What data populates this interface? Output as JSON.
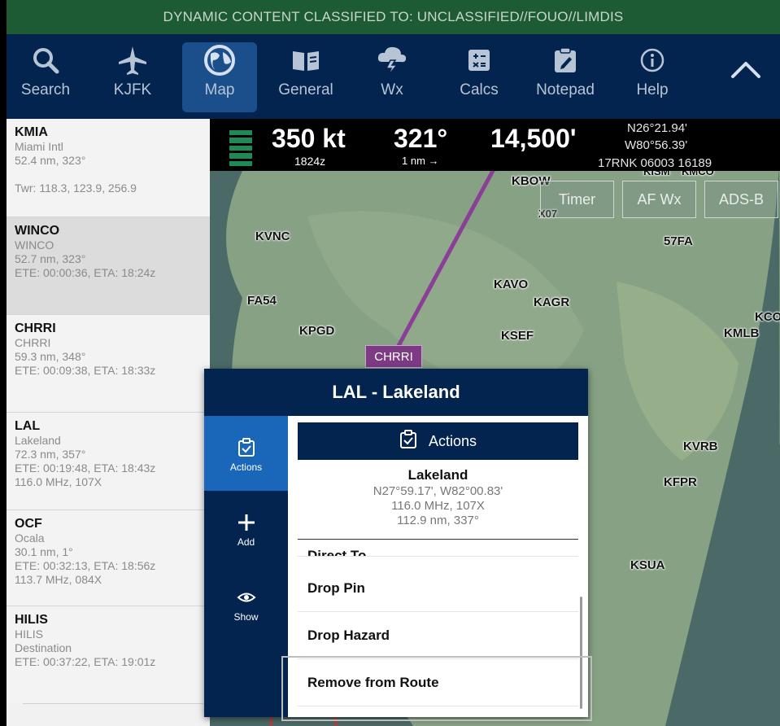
{
  "banner": "DYNAMIC CONTENT CLASSIFIED TO: UNCLASSIFIED//FOUO//LIMDIS",
  "nav": {
    "items": [
      {
        "label": "Search",
        "icon": "search-icon"
      },
      {
        "label": "KJFK",
        "icon": "airplane-icon"
      },
      {
        "label": "Map",
        "icon": "globe-icon"
      },
      {
        "label": "General",
        "icon": "book-icon"
      },
      {
        "label": "Wx",
        "icon": "storm-cloud-icon"
      },
      {
        "label": "Calcs",
        "icon": "calculator-icon"
      },
      {
        "label": "Notepad",
        "icon": "notepad-icon"
      },
      {
        "label": "Help",
        "icon": "info-icon"
      }
    ],
    "active": "Map"
  },
  "waypoints": [
    {
      "id": "KMIA",
      "lines": [
        "Miami Intl",
        "52.4 nm, 323°",
        "",
        "Twr: 118.3, 123.9, 256.9"
      ]
    },
    {
      "id": "WINCO",
      "lines": [
        "WINCO",
        "52.7 nm, 323°",
        "ETE: 00:00:36, ETA: 18:24z"
      ]
    },
    {
      "id": "CHRRI",
      "lines": [
        "CHRRI",
        "59.3 nm, 348°",
        "ETE: 00:09:38, ETA: 18:33z"
      ]
    },
    {
      "id": "LAL",
      "lines": [
        "Lakeland",
        "72.3 nm, 357°",
        "ETE: 00:19:48, ETA: 18:43z",
        "116.0 MHz, 107X"
      ]
    },
    {
      "id": "OCF",
      "lines": [
        "Ocala",
        "30.1 nm, 1°",
        "ETE: 00:32:13, ETA: 18:56z",
        "113.7 MHz, 084X"
      ]
    },
    {
      "id": "HILIS",
      "lines": [
        "HILIS",
        "Destination",
        "ETE: 00:37:22, ETA: 19:01z"
      ]
    }
  ],
  "hud": {
    "speed": "350 kt",
    "time": "1824z",
    "heading": "321°",
    "scale": "1 nm →",
    "altitude": "14,500'",
    "lat": "N26°21.94'",
    "lon": "W80°56.39'",
    "grid": "17RNK 06003 16189"
  },
  "map_buttons": [
    "Timer",
    "AF Wx",
    "ADS-B"
  ],
  "map_labels": [
    "KBOW",
    "X07",
    "KISM",
    "KMCO",
    "KVNC",
    "57FA",
    "KAVO",
    "KAGR",
    "FA54",
    "KPGD",
    "KSEF",
    "KMLB",
    "KCOI",
    "CHRRI",
    "KVRB",
    "KFPR",
    "KSUA"
  ],
  "popup": {
    "title": "LAL - Lakeland",
    "side": [
      {
        "label": "Actions",
        "icon": "clipboard-check-icon"
      },
      {
        "label": "Add",
        "icon": "plus-icon"
      },
      {
        "label": "Show",
        "icon": "eye-icon"
      }
    ],
    "actions_label": "Actions",
    "info": {
      "name": "Lakeland",
      "coords": "N27°59.17',  W82°00.83'",
      "freq": "116.0 MHz, 107X",
      "dist": "112.9 nm, 337°"
    },
    "rows": [
      "Direct To",
      "Drop Pin",
      "Drop Hazard",
      "Remove from Route"
    ]
  }
}
